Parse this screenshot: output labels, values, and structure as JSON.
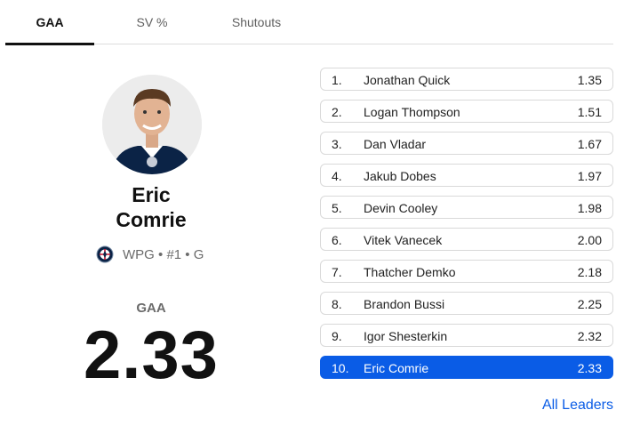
{
  "tabs": [
    {
      "label": "GAA",
      "active": true
    },
    {
      "label": "SV %",
      "active": false
    },
    {
      "label": "Shutouts",
      "active": false
    }
  ],
  "featured": {
    "first_name": "Eric",
    "last_name": "Comrie",
    "team": "WPG",
    "number": "#1",
    "position": "G",
    "team_logo_icon": "jets-logo-icon",
    "stat_label": "GAA",
    "stat_value": "2.33"
  },
  "leaders": [
    {
      "rank": "1.",
      "name": "Jonathan Quick",
      "value": "1.35"
    },
    {
      "rank": "2.",
      "name": "Logan Thompson",
      "value": "1.51"
    },
    {
      "rank": "3.",
      "name": "Dan Vladar",
      "value": "1.67"
    },
    {
      "rank": "4.",
      "name": "Jakub Dobes",
      "value": "1.97"
    },
    {
      "rank": "5.",
      "name": "Devin Cooley",
      "value": "1.98"
    },
    {
      "rank": "6.",
      "name": "Vitek Vanecek",
      "value": "2.00"
    },
    {
      "rank": "7.",
      "name": "Thatcher Demko",
      "value": "2.18"
    },
    {
      "rank": "8.",
      "name": "Brandon Bussi",
      "value": "2.25"
    },
    {
      "rank": "9.",
      "name": "Igor Shesterkin",
      "value": "2.32"
    },
    {
      "rank": "10.",
      "name": "Eric Comrie",
      "value": "2.33",
      "active": true
    }
  ],
  "all_leaders_label": "All Leaders",
  "colors": {
    "accent": "#0a5ce6",
    "text": "#111111",
    "muted": "#6b6b6b",
    "border": "#d9d9d9"
  }
}
